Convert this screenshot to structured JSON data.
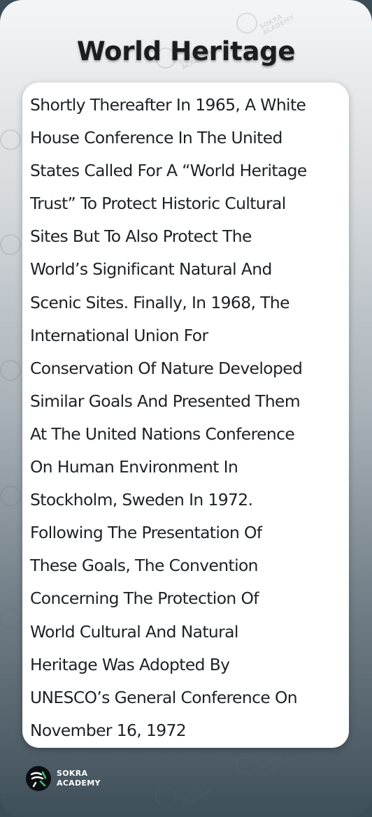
{
  "title": "World Heritage",
  "body": "Shortly Thereafter In 1965, A White\nHouse Conference In The United\nStates Called For A “World Heritage\nTrust” To Protect Historic Cultural\nSites But To Also Protect The\nWorld’s Significant Natural And\nScenic Sites. Finally, In 1968, The\nInternational Union For\nConservation Of Nature Developed\nSimilar Goals And Presented Them\nAt The United Nations Conference\nOn Human Environment In\nStockholm, Sweden In 1972.\nFollowing The Presentation Of\nThese Goals, The Convention\nConcerning The Protection Of\nWorld Cultural And Natural\nHeritage Was Adopted By\nUNESCO’s General Conference On\nNovember 16, 1972",
  "brand": {
    "line1": "SOKRA",
    "line2": "ACADEMY",
    "logo_icon": "sokra-academy-logo-icon"
  },
  "colors": {
    "title": "#1b1d1f",
    "panel": "#ffffff",
    "text": "#1e2124",
    "bg_top": "#f4f5f6",
    "bg_bottom": "#3f4f59"
  }
}
